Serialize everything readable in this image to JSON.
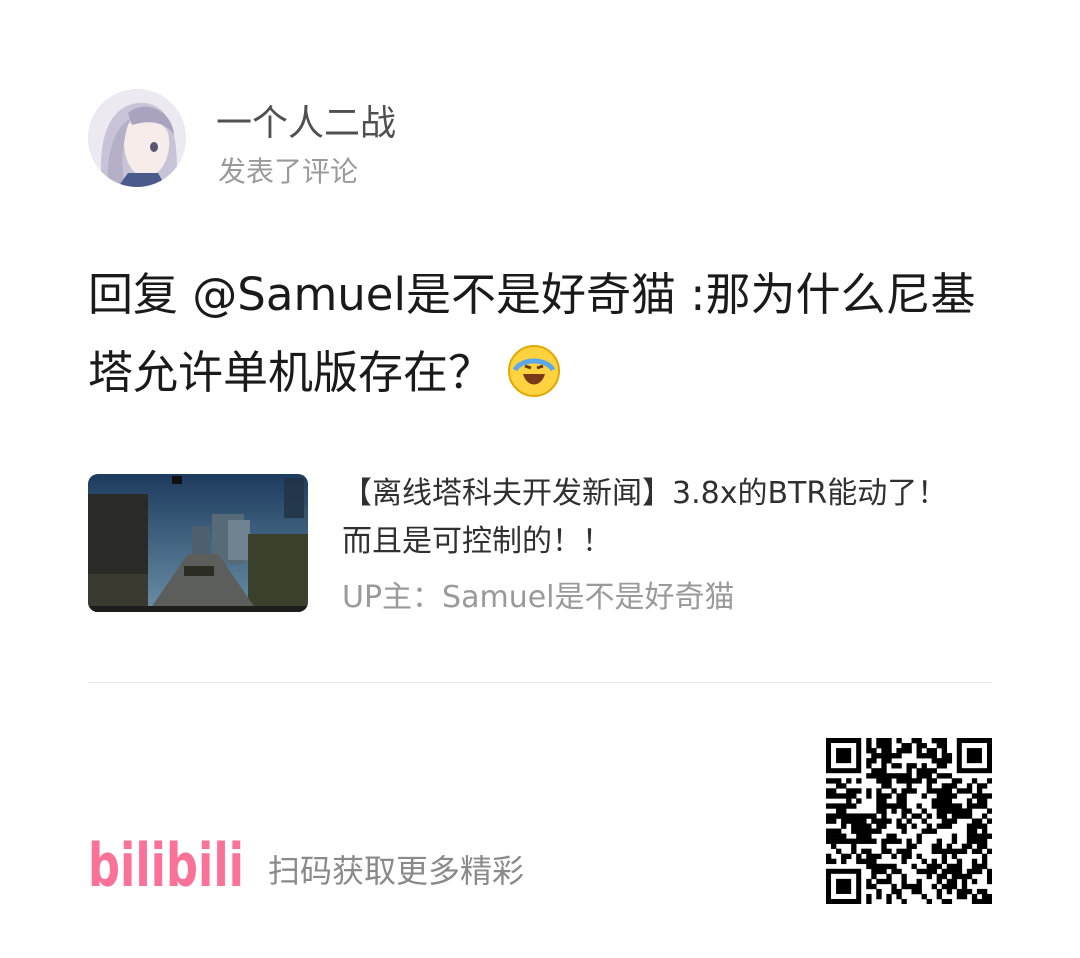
{
  "user": {
    "name": "一个人二战",
    "action": "发表了评论"
  },
  "comment": {
    "text": "回复 @Samuel是不是好奇猫 :那为什么尼基塔允许单机版存在？",
    "emoji": "laughing-crying-face-icon"
  },
  "video": {
    "title": "【离线塔科夫开发新闻】3.8x的BTR能动了！而且是可控制的！！",
    "uploader": "UP主：Samuel是不是好奇猫"
  },
  "footer": {
    "logo_text": "bilibili",
    "cta": "扫码获取更多精彩"
  },
  "colors": {
    "brand_pink": "#fb7299"
  }
}
